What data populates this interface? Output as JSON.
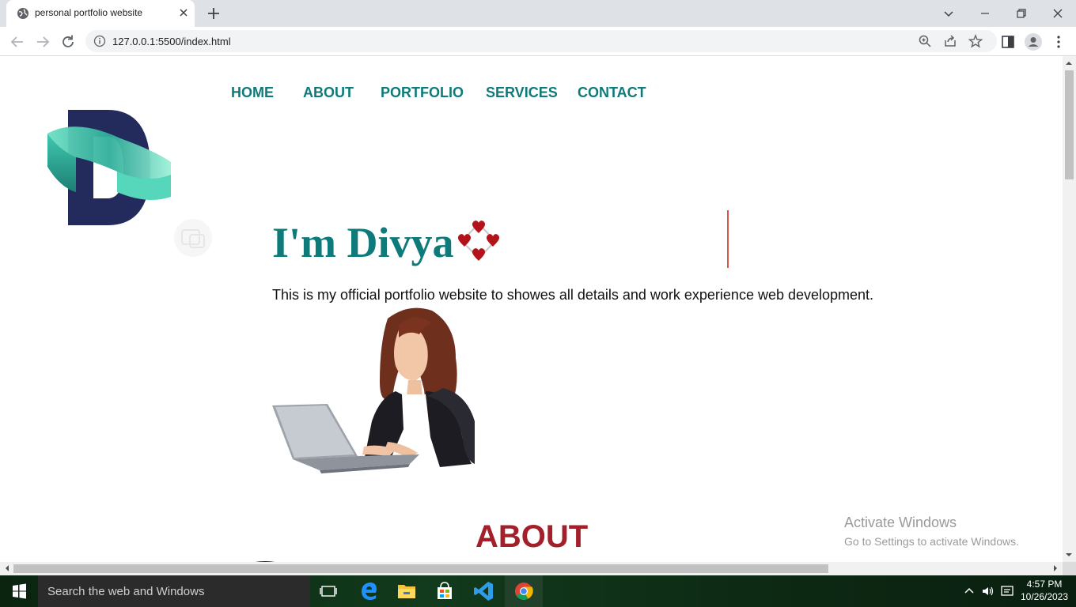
{
  "browser": {
    "tab_title": "personal portfolio website",
    "url": "127.0.0.1:5500/index.html"
  },
  "site": {
    "nav": [
      {
        "label": "HOME"
      },
      {
        "label": "ABOUT"
      },
      {
        "label": "PORTFOLIO"
      },
      {
        "label": "SERVICES"
      },
      {
        "label": "CONTACT"
      }
    ],
    "hero_title": "I'm Divya",
    "hero_description": "This is my official portfolio website to showes all details and work experience web development.",
    "about_heading": "ABOUT"
  },
  "watermark": {
    "title": "Activate Windows",
    "subtitle": "Go to Settings to activate Windows."
  },
  "taskbar": {
    "search_placeholder": "Search the web and Windows",
    "time": "4:57 PM",
    "date": "10/26/2023"
  },
  "colors": {
    "nav_text": "#0e7a7a",
    "hero_title": "#0e7a7a",
    "about_heading": "#a3202a",
    "logo_letter": "#232a5c",
    "logo_ribbon": "#3fc9b0"
  }
}
